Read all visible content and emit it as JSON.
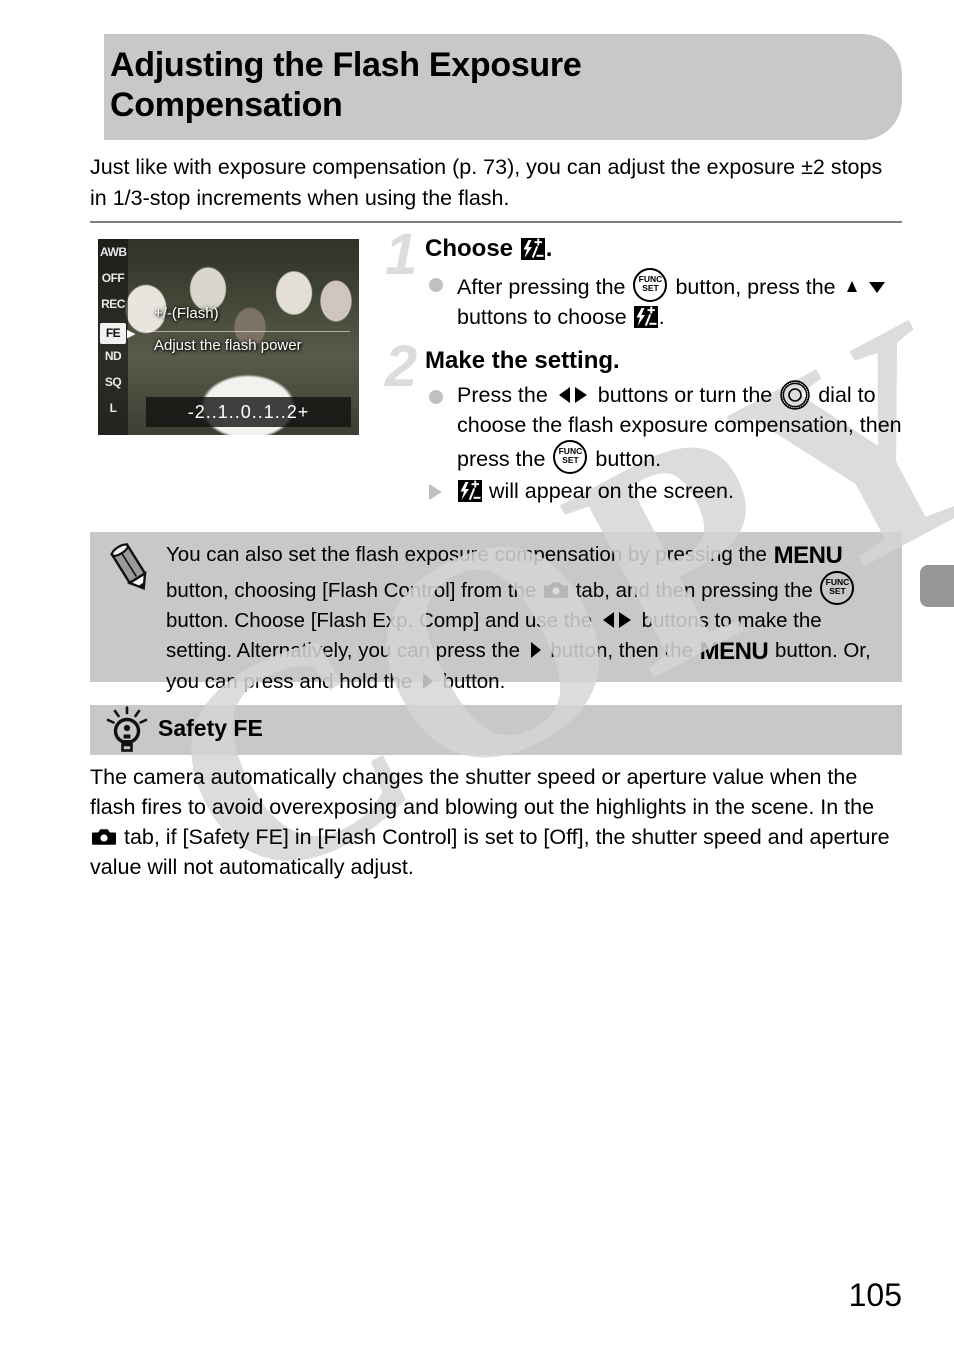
{
  "page": {
    "title": "Adjusting the Flash Exposure Compensation",
    "title_line1": "Adjusting the Flash Exposure",
    "title_line2": "Compensation",
    "intro": "Just like with exposure compensation (p. 73), you can adjust the exposure ±2 stops in 1/3-stop increments when using the flash.",
    "page_number": "105",
    "watermark": "COPY",
    "banner_color": "#c8c8c8",
    "rule_color": "#808080",
    "edge_tab_color": "#969696",
    "step_number_color": "#dcdcdc"
  },
  "screenshot": {
    "title_label": "+/-(Flash)",
    "hint_label": "Adjust the flash power",
    "scale_label": "-2..1..0..1..2+",
    "left_menu": [
      {
        "label": "AWB",
        "selected": false
      },
      {
        "label": "OFF",
        "selected": false
      },
      {
        "label": "REC",
        "selected": false
      },
      {
        "label": "FE",
        "selected": true
      },
      {
        "label": "ND",
        "selected": false
      },
      {
        "label": "SQ",
        "selected": false
      },
      {
        "label": "L",
        "selected": false
      }
    ]
  },
  "steps": [
    {
      "number": "1",
      "heading_prefix": "Choose ",
      "heading_icon": "flash-exposure-icon",
      "heading_suffix": ".",
      "bullets": [
        {
          "type": "dot",
          "parts": [
            {
              "t": "text",
              "v": "After pressing the "
            },
            {
              "t": "icon",
              "v": "func-set-icon"
            },
            {
              "t": "text",
              "v": " button, press the "
            },
            {
              "t": "icon",
              "v": "up-down-buttons-icon"
            },
            {
              "t": "text",
              "v": " buttons to choose "
            },
            {
              "t": "icon",
              "v": "flash-exposure-icon"
            },
            {
              "t": "text",
              "v": "."
            }
          ]
        }
      ]
    },
    {
      "number": "2",
      "heading_prefix": "Make the setting.",
      "heading_icon": "",
      "heading_suffix": "",
      "bullets": [
        {
          "type": "dot",
          "parts": [
            {
              "t": "text",
              "v": "Press the "
            },
            {
              "t": "icon",
              "v": "left-right-buttons-icon"
            },
            {
              "t": "text",
              "v": " buttons or turn the "
            },
            {
              "t": "icon",
              "v": "control-dial-icon"
            },
            {
              "t": "text",
              "v": " dial to choose the flash exposure compensation, then press the "
            },
            {
              "t": "icon",
              "v": "func-set-icon"
            },
            {
              "t": "text",
              "v": " button."
            }
          ]
        },
        {
          "type": "triangle",
          "parts": [
            {
              "t": "icon",
              "v": "flash-exposure-icon"
            },
            {
              "t": "text",
              "v": " will appear on the screen."
            }
          ]
        }
      ]
    }
  ],
  "note": {
    "icon": "pencil-icon",
    "parts": [
      {
        "t": "text",
        "v": "You can also set the flash exposure compensation by pressing the "
      },
      {
        "t": "icon",
        "v": "menu-button-icon"
      },
      {
        "t": "text",
        "v": " button, choosing [Flash Control] from the "
      },
      {
        "t": "icon",
        "v": "camera-tab-icon"
      },
      {
        "t": "text",
        "v": " tab, and then pressing the "
      },
      {
        "t": "icon",
        "v": "func-set-icon"
      },
      {
        "t": "text",
        "v": " button. Choose [Flash Exp. Comp] and use the "
      },
      {
        "t": "icon",
        "v": "left-right-buttons-icon"
      },
      {
        "t": "text",
        "v": " buttons to make the setting. Alternatively, you can press the "
      },
      {
        "t": "icon",
        "v": "right-button-icon"
      },
      {
        "t": "text",
        "v": " button, then the "
      },
      {
        "t": "icon",
        "v": "menu-button-icon"
      },
      {
        "t": "text",
        "v": " button. Or, you can press and hold the "
      },
      {
        "t": "icon",
        "v": "right-button-icon"
      },
      {
        "t": "text",
        "v": " button."
      }
    ]
  },
  "tip": {
    "icon": "lightbulb-icon",
    "title": "Safety FE",
    "parts": [
      {
        "t": "text",
        "v": "The camera automatically changes the shutter speed or aperture value when the flash fires to avoid overexposing and blowing out the highlights in the scene. In the "
      },
      {
        "t": "icon",
        "v": "camera-tab-icon"
      },
      {
        "t": "text",
        "v": " tab, if [Safety FE] in [Flash Control] is set to [Off], the shutter speed and aperture value will not automatically adjust."
      }
    ]
  },
  "icon_labels": {
    "flash-exposure-icon": "flash exposure compensation",
    "func-set-icon": "FUNC SET button",
    "up-down-buttons-icon": "up down buttons",
    "left-right-buttons-icon": "left right buttons",
    "right-button-icon": "right button",
    "control-dial-icon": "control dial",
    "camera-tab-icon": "camera tab",
    "menu-button-icon": "MENU",
    "pencil-icon": "pencil",
    "lightbulb-icon": "light bulb"
  }
}
